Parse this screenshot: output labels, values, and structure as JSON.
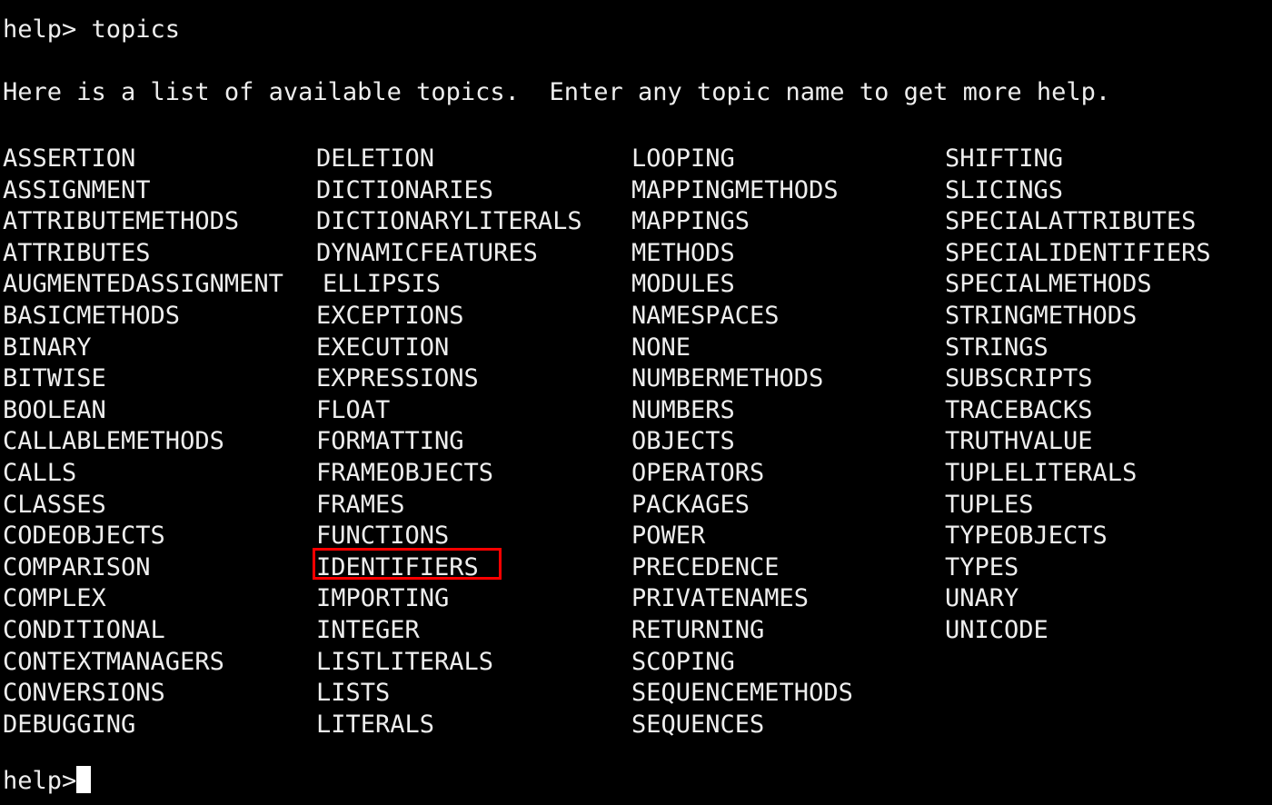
{
  "terminal": {
    "background_color": "#000000",
    "text_color": "#eeeeee",
    "prompt": "help>",
    "command_line": "help> topics",
    "intro_line": "Here is a list of available topics.  Enter any topic name to get more help.",
    "tail_prompt": "help>",
    "cursor": "block-cursor"
  },
  "annotation": {
    "highlight_target": "IDENTIFIERS",
    "color": "#ff0000",
    "shape": "rectangle-outline"
  },
  "topics_grid": {
    "column_count": 4,
    "row_count": 19,
    "columns": [
      [
        "ASSERTION",
        "ASSIGNMENT",
        "ATTRIBUTEMETHODS",
        "ATTRIBUTES",
        "AUGMENTEDASSIGNMENT",
        "BASICMETHODS",
        "BINARY",
        "BITWISE",
        "BOOLEAN",
        "CALLABLEMETHODS",
        "CALLS",
        "CLASSES",
        "CODEOBJECTS",
        "COMPARISON",
        "COMPLEX",
        "CONDITIONAL",
        "CONTEXTMANAGERS",
        "CONVERSIONS",
        "DEBUGGING"
      ],
      [
        "DELETION",
        "DICTIONARIES",
        "DICTIONARYLITERALS",
        "DYNAMICFEATURES",
        "ELLIPSIS",
        "EXCEPTIONS",
        "EXECUTION",
        "EXPRESSIONS",
        "FLOAT",
        "FORMATTING",
        "FRAMEOBJECTS",
        "FRAMES",
        "FUNCTIONS",
        "IDENTIFIERS",
        "IMPORTING",
        "INTEGER",
        "LISTLITERALS",
        "LISTS",
        "LITERALS"
      ],
      [
        "LOOPING",
        "MAPPINGMETHODS",
        "MAPPINGS",
        "METHODS",
        "MODULES",
        "NAMESPACES",
        "NONE",
        "NUMBERMETHODS",
        "NUMBERS",
        "OBJECTS",
        "OPERATORS",
        "PACKAGES",
        "POWER",
        "PRECEDENCE",
        "PRIVATENAMES",
        "RETURNING",
        "SCOPING",
        "SEQUENCEMETHODS",
        "SEQUENCES"
      ],
      [
        "SHIFTING",
        "SLICINGS",
        "SPECIALATTRIBUTES",
        "SPECIALIDENTIFIERS",
        "SPECIALMETHODS",
        "STRINGMETHODS",
        "STRINGS",
        "SUBSCRIPTS",
        "TRACEBACKS",
        "TRUTHVALUE",
        "TUPLELITERALS",
        "TUPLES",
        "TYPEOBJECTS",
        "TYPES",
        "UNARY",
        "UNICODE",
        "",
        "",
        ""
      ]
    ]
  }
}
